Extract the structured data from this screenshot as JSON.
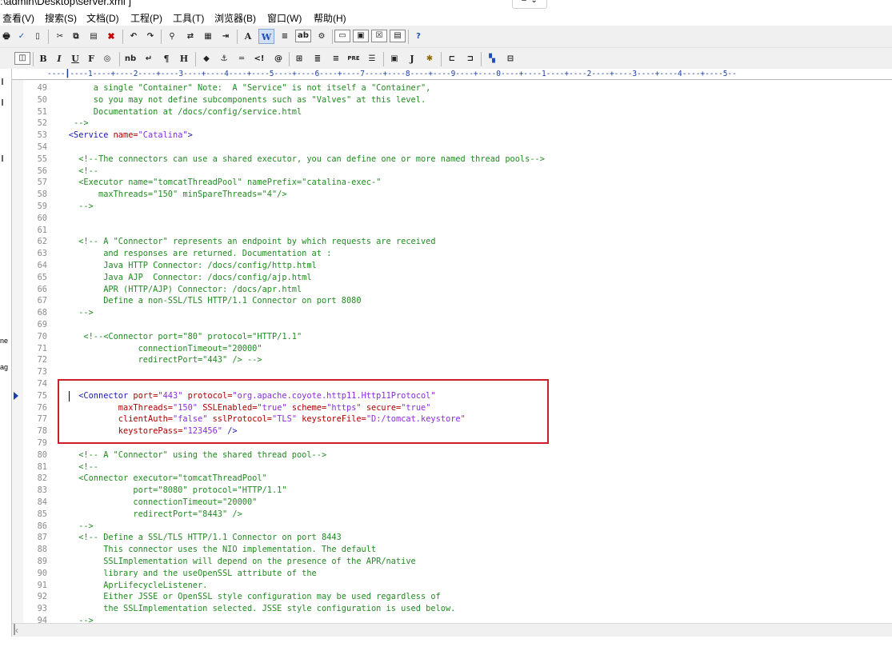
{
  "window": {
    "title": ":\\admin\\Desktop\\server.xml  ]"
  },
  "menu": [
    "查看(V)",
    "搜索(S)",
    "文档(D)",
    "工程(P)",
    "工具(T)",
    "浏览器(B)",
    "窗口(W)",
    "帮助(H)"
  ],
  "toolbar2_labels": {
    "bold": "B",
    "italic": "I",
    "underline": "U",
    "font": "F",
    "nbsp": "nb",
    "pilcrow": "¶",
    "heading": "H",
    "anchor": "⚓",
    "pre": "PRE",
    "javascript": "J"
  },
  "ruler": "----┃----1----+----2----+----3----+----4----+----5----+----6----+----7----+----8----+----9----+----0----+----1----+----2----+----3----+----4----+----5--",
  "colors": {
    "comment": "#228B22",
    "tag": "#1a1ab0",
    "attr": "#b00000",
    "value": "#8a2be2",
    "highlight_box": "#cc1f2a"
  },
  "editor": {
    "caret_line": 75,
    "lines": [
      {
        "n": "49",
        "seg": [
          {
            "t": "         a single \"Container\" Note:  A \"Service\" is not itself a \"Container\",",
            "c": "c"
          }
        ]
      },
      {
        "n": "50",
        "seg": [
          {
            "t": "         so you may not define subcomponents such as \"Valves\" at this level.",
            "c": "c"
          }
        ]
      },
      {
        "n": "51",
        "seg": [
          {
            "t": "         Documentation at /docs/config/service.html",
            "c": "c"
          }
        ]
      },
      {
        "n": "52",
        "seg": [
          {
            "t": "     -->",
            "c": "c"
          }
        ]
      },
      {
        "n": "53",
        "seg": [
          {
            "t": "    <Service ",
            "c": "t"
          },
          {
            "t": "name=",
            "c": "a"
          },
          {
            "t": "\"Catalina\"",
            "c": "v"
          },
          {
            "t": ">",
            "c": "t"
          }
        ]
      },
      {
        "n": "54",
        "seg": []
      },
      {
        "n": "55",
        "seg": [
          {
            "t": "      <!--The connectors can use a shared executor, you can define one or more named thread pools-->",
            "c": "c"
          }
        ]
      },
      {
        "n": "56",
        "seg": [
          {
            "t": "      <!--",
            "c": "c"
          }
        ]
      },
      {
        "n": "57",
        "seg": [
          {
            "t": "      <Executor name=\"tomcatThreadPool\" namePrefix=\"catalina-exec-\"",
            "c": "c"
          }
        ]
      },
      {
        "n": "58",
        "seg": [
          {
            "t": "          maxThreads=\"150\" minSpareThreads=\"4\"/>",
            "c": "c"
          }
        ]
      },
      {
        "n": "59",
        "seg": [
          {
            "t": "      -->",
            "c": "c"
          }
        ]
      },
      {
        "n": "60",
        "seg": []
      },
      {
        "n": "61",
        "seg": []
      },
      {
        "n": "62",
        "seg": [
          {
            "t": "      <!-- A \"Connector\" represents an endpoint by which requests are received",
            "c": "c"
          }
        ]
      },
      {
        "n": "63",
        "seg": [
          {
            "t": "           and responses are returned. Documentation at :",
            "c": "c"
          }
        ]
      },
      {
        "n": "64",
        "seg": [
          {
            "t": "           Java HTTP Connector: /docs/config/http.html",
            "c": "c"
          }
        ]
      },
      {
        "n": "65",
        "seg": [
          {
            "t": "           Java AJP  Connector: /docs/config/ajp.html",
            "c": "c"
          }
        ]
      },
      {
        "n": "66",
        "seg": [
          {
            "t": "           APR (HTTP/AJP) Connector: /docs/apr.html",
            "c": "c"
          }
        ]
      },
      {
        "n": "67",
        "seg": [
          {
            "t": "           Define a non-SSL/TLS HTTP/1.1 Connector on port 8080",
            "c": "c"
          }
        ]
      },
      {
        "n": "68",
        "seg": [
          {
            "t": "      -->",
            "c": "c"
          }
        ]
      },
      {
        "n": "69",
        "seg": []
      },
      {
        "n": "70",
        "seg": [
          {
            "t": "       <!--<Connector port=\"80\" protocol=\"HTTP/1.1\"",
            "c": "c"
          }
        ]
      },
      {
        "n": "71",
        "seg": [
          {
            "t": "                  connectionTimeout=\"20000\"",
            "c": "c"
          }
        ]
      },
      {
        "n": "72",
        "seg": [
          {
            "t": "                  redirectPort=\"443\" /> -->",
            "c": "c"
          }
        ]
      },
      {
        "n": "73",
        "seg": []
      },
      {
        "n": "74",
        "seg": []
      },
      {
        "n": "75",
        "seg": [
          {
            "t": "      <Connector ",
            "c": "t"
          },
          {
            "t": "port=",
            "c": "a"
          },
          {
            "t": "\"443\"",
            "c": "v"
          },
          {
            "t": " ",
            "c": "t"
          },
          {
            "t": "protocol=",
            "c": "a"
          },
          {
            "t": "\"org.apache.coyote.http11.Http11Protocol\"",
            "c": "v"
          }
        ]
      },
      {
        "n": "76",
        "seg": [
          {
            "t": "              ",
            "c": "t"
          },
          {
            "t": "maxThreads=",
            "c": "a"
          },
          {
            "t": "\"150\"",
            "c": "v"
          },
          {
            "t": " ",
            "c": "t"
          },
          {
            "t": "SSLEnabled=",
            "c": "a"
          },
          {
            "t": "\"true\"",
            "c": "v"
          },
          {
            "t": " ",
            "c": "t"
          },
          {
            "t": "scheme=",
            "c": "a"
          },
          {
            "t": "\"https\"",
            "c": "v"
          },
          {
            "t": " ",
            "c": "t"
          },
          {
            "t": "secure=",
            "c": "a"
          },
          {
            "t": "\"true\"",
            "c": "v"
          }
        ]
      },
      {
        "n": "77",
        "seg": [
          {
            "t": "              ",
            "c": "t"
          },
          {
            "t": "clientAuth=",
            "c": "a"
          },
          {
            "t": "\"false\"",
            "c": "v"
          },
          {
            "t": " ",
            "c": "t"
          },
          {
            "t": "sslProtocol=",
            "c": "a"
          },
          {
            "t": "\"TLS\"",
            "c": "v"
          },
          {
            "t": " ",
            "c": "t"
          },
          {
            "t": "keystoreFile=",
            "c": "a"
          },
          {
            "t": "\"D:/tomcat.keystore\"",
            "c": "v"
          }
        ]
      },
      {
        "n": "78",
        "seg": [
          {
            "t": "              ",
            "c": "t"
          },
          {
            "t": "keystorePass=",
            "c": "a"
          },
          {
            "t": "\"123456\"",
            "c": "v"
          },
          {
            "t": " />",
            "c": "t"
          }
        ]
      },
      {
        "n": "79",
        "seg": []
      },
      {
        "n": "80",
        "seg": [
          {
            "t": "      <!-- A \"Connector\" using the shared thread pool-->",
            "c": "c"
          }
        ]
      },
      {
        "n": "81",
        "seg": [
          {
            "t": "      <!--",
            "c": "c"
          }
        ]
      },
      {
        "n": "82",
        "seg": [
          {
            "t": "      <Connector executor=\"tomcatThreadPool\"",
            "c": "c"
          }
        ]
      },
      {
        "n": "83",
        "seg": [
          {
            "t": "                 port=\"8080\" protocol=\"HTTP/1.1\"",
            "c": "c"
          }
        ]
      },
      {
        "n": "84",
        "seg": [
          {
            "t": "                 connectionTimeout=\"20000\"",
            "c": "c"
          }
        ]
      },
      {
        "n": "85",
        "seg": [
          {
            "t": "                 redirectPort=\"8443\" />",
            "c": "c"
          }
        ]
      },
      {
        "n": "86",
        "seg": [
          {
            "t": "      -->",
            "c": "c"
          }
        ]
      },
      {
        "n": "87",
        "seg": [
          {
            "t": "      <!-- Define a SSL/TLS HTTP/1.1 Connector on port 8443",
            "c": "c"
          }
        ]
      },
      {
        "n": "88",
        "seg": [
          {
            "t": "           This connector uses the NIO implementation. The default",
            "c": "c"
          }
        ]
      },
      {
        "n": "89",
        "seg": [
          {
            "t": "           SSLImplementation will depend on the presence of the APR/native",
            "c": "c"
          }
        ]
      },
      {
        "n": "90",
        "seg": [
          {
            "t": "           library and the useOpenSSL attribute of the",
            "c": "c"
          }
        ]
      },
      {
        "n": "91",
        "seg": [
          {
            "t": "           AprLifecycleListener.",
            "c": "c"
          }
        ]
      },
      {
        "n": "92",
        "seg": [
          {
            "t": "           Either JSSE or OpenSSL style configuration may be used regardless of",
            "c": "c"
          }
        ]
      },
      {
        "n": "93",
        "seg": [
          {
            "t": "           the SSLImplementation selected. JSSE style configuration is used below.",
            "c": "c"
          }
        ]
      },
      {
        "n": "94",
        "seg": [
          {
            "t": "      -->",
            "c": "c"
          }
        ]
      }
    ]
  },
  "left_panel_fragments": [
    "ne",
    "ag"
  ]
}
